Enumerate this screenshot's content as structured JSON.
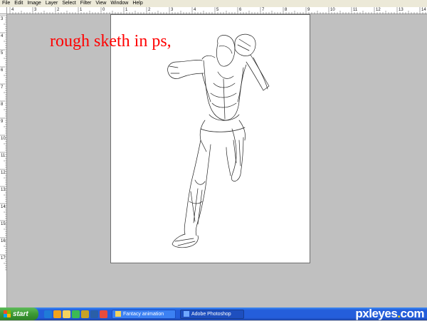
{
  "menu": [
    "File",
    "Edit",
    "Image",
    "Layer",
    "Select",
    "Filter",
    "View",
    "Window",
    "Help"
  ],
  "annotation_text": "rough sketh in ps,",
  "ruler_top_labels": [
    "4",
    "3",
    "2",
    "1",
    "0",
    "1",
    "2",
    "3",
    "4",
    "5",
    "6",
    "7",
    "8",
    "9",
    "10",
    "11",
    "12",
    "13",
    "14"
  ],
  "ruler_left_labels": [
    "3",
    "4",
    "5",
    "6",
    "7",
    "8",
    "9",
    "10",
    "11",
    "12",
    "13",
    "14",
    "15",
    "16",
    "17"
  ],
  "taskbar": {
    "start_label": "start",
    "quick_launch_icons": [
      "ie-icon",
      "media-icon",
      "folder-icon",
      "messenger-icon",
      "app-icon",
      "photoshop-icon",
      "printer-icon"
    ],
    "tasks": [
      {
        "label": "Fantacy animation",
        "icon": "folder-icon",
        "active": false
      },
      {
        "label": "Adobe Photoshop",
        "icon": "photoshop-icon",
        "active": true
      }
    ]
  },
  "watermark": {
    "brand": "pxleyes",
    "tld": "com"
  },
  "colors": {
    "annotation": "#ff0000",
    "taskbar": "#245edb",
    "start": "#3c9a34",
    "workspace": "#c0c0c0"
  }
}
